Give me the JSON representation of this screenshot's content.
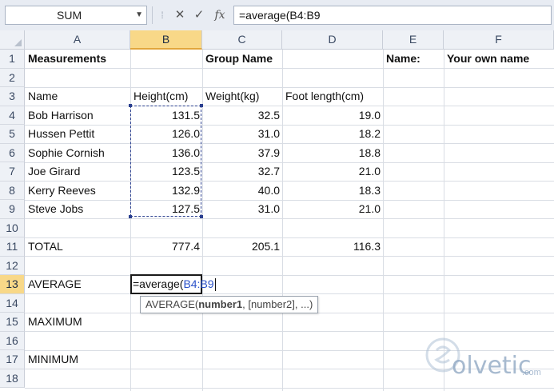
{
  "formula_bar": {
    "name_box": "SUM",
    "cancel_symbol": "✕",
    "enter_symbol": "✓",
    "fx_label": "fx",
    "formula": "=average(B4:B9"
  },
  "columns": [
    "A",
    "B",
    "C",
    "D",
    "E",
    "F"
  ],
  "selected_column": "B",
  "rows": [
    "1",
    "2",
    "3",
    "4",
    "5",
    "6",
    "7",
    "8",
    "9",
    "10",
    "11",
    "12",
    "13",
    "14",
    "15",
    "16",
    "17",
    "18"
  ],
  "selected_row": "13",
  "cells": {
    "A1": "Measurements",
    "C1": "Group Name",
    "E1": "Name:",
    "F1": "Your own name",
    "A3": "Name",
    "B3": "Height(cm)",
    "C3": "Weight(kg)",
    "D3": "Foot length(cm)",
    "A4": "Bob Harrison",
    "B4": "131.5",
    "C4": "32.5",
    "D4": "19.0",
    "A5": "Hussen Pettit",
    "B5": "126.0",
    "C5": "31.0",
    "D5": "18.2",
    "A6": "Sophie Cornish",
    "B6": "136.0",
    "C6": "37.9",
    "D6": "18.8",
    "A7": "Joe Girard",
    "B7": "123.5",
    "C7": "32.7",
    "D7": "21.0",
    "A8": "Kerry Reeves",
    "B8": "132.9",
    "C8": "40.0",
    "D8": "18.3",
    "A9": "Steve Jobs",
    "B9": "127.5",
    "C9": "31.0",
    "D9": "21.0",
    "A11": "TOTAL",
    "B11": "777.4",
    "C11": "205.1",
    "D11": "116.3",
    "A13": "AVERAGE",
    "A15": "MAXIMUM",
    "A17": "MINIMUM"
  },
  "active_cell": {
    "address": "B13",
    "edit_prefix": "=average(",
    "edit_ref": "B4:B9"
  },
  "tooltip": {
    "func": "AVERAGE(",
    "arg_bold": "number1",
    "rest": ", [number2], ...)"
  },
  "watermark": {
    "text": "olvetic",
    "suffix": ".com"
  },
  "colors": {
    "selected_header": "#f8d888",
    "reference_blue": "#2b52c9",
    "marquee": "#2a3f8f"
  }
}
